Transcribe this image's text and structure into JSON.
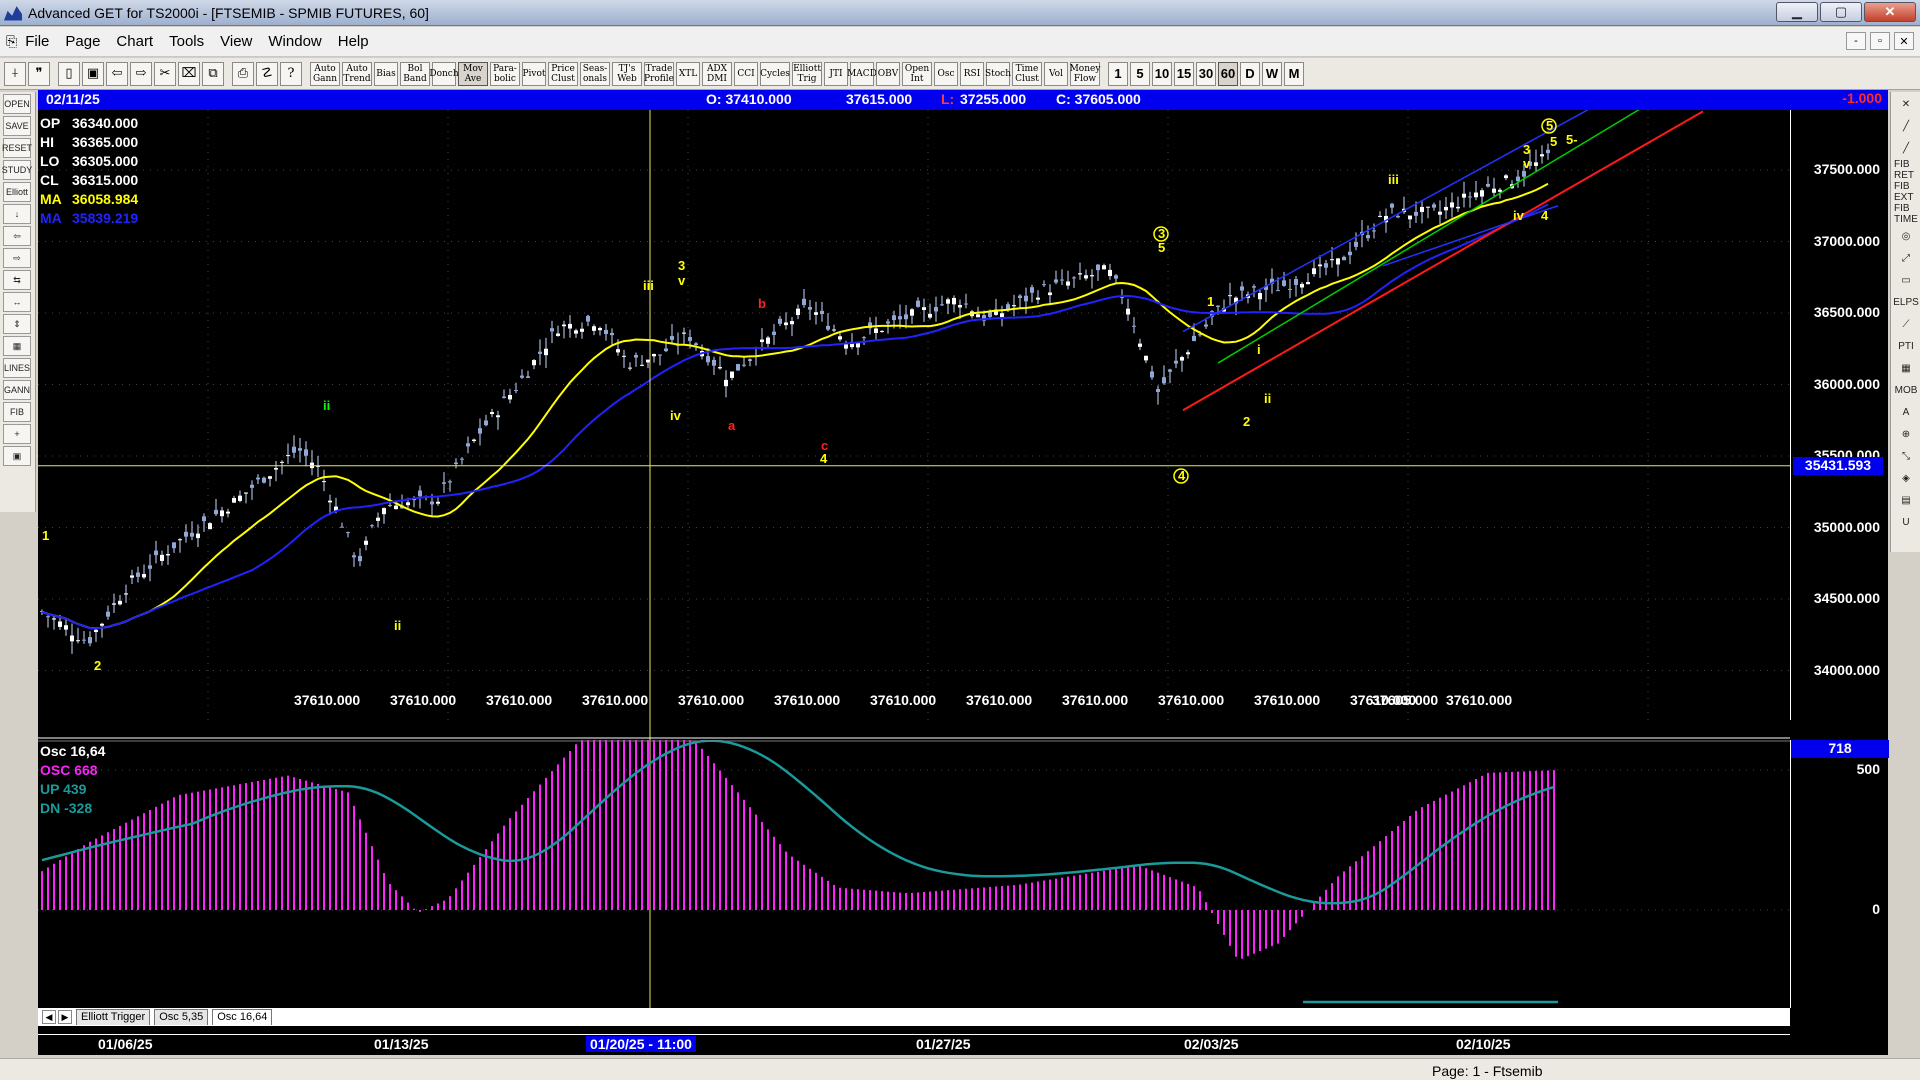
{
  "window": {
    "title": "Advanced GET for TS2000i - [FTSEMIB - SPMIB FUTURES, 60]"
  },
  "menu": [
    "File",
    "Page",
    "Chart",
    "Tools",
    "View",
    "Window",
    "Help"
  ],
  "toolbar_studies": [
    "Auto Gann",
    "Auto Trend",
    "Bias",
    "Bol Band",
    "Donch",
    "Mov Ave",
    "Para- bolic",
    "Pivot",
    "Price Clust",
    "Seas- onals",
    "TJ's Web",
    "Trade Profile",
    "XTL",
    "ADX DMI",
    "CCI",
    "Cycles",
    "Elliott Trig",
    "JTI",
    "MACD",
    "OBV",
    "Open Int",
    "Osc",
    "RSI",
    "Stoch",
    "Time Clust",
    "Vol",
    "Money Flow"
  ],
  "toolbar_periods": [
    "1",
    "5",
    "10",
    "15",
    "30",
    "60",
    "D",
    "W",
    "M"
  ],
  "left_tools": [
    "OPEN",
    "SAVE",
    "RESET",
    "STUDY",
    "Elliott",
    "↓",
    "⇦",
    "⇨",
    "⇆",
    "↔",
    "⇕",
    "▦",
    "LINES",
    "GANN",
    "FIB",
    "+",
    "▣"
  ],
  "right_tools": [
    "✕",
    "╱",
    "╱",
    "FIB RET",
    "FIB EXT",
    "FIB TIME",
    "◎",
    "⤢",
    "▭",
    "ELPS",
    "⟋",
    "PTI",
    "▦",
    "MOB",
    "A",
    "⊕",
    "⤡",
    "◈",
    "▤",
    "U"
  ],
  "infobar": {
    "date": "02/11/25",
    "open": "O: 37410.000",
    "high": "37615.000",
    "low_label": "L:",
    "low": "37255.000",
    "close": "C: 37605.000",
    "last": "-1.000"
  },
  "stats": [
    {
      "k": "OP",
      "v": "36340.000",
      "color": "#ffffff"
    },
    {
      "k": "HI",
      "v": "36365.000",
      "color": "#ffffff"
    },
    {
      "k": "LO",
      "v": "36305.000",
      "color": "#ffffff"
    },
    {
      "k": "CL",
      "v": "36315.000",
      "color": "#ffffff"
    },
    {
      "k": "MA",
      "v": "36058.984",
      "color": "#ffff00"
    },
    {
      "k": "MA",
      "v": "35839.219",
      "color": "#2222ff"
    }
  ],
  "price_axis": [
    "37500.000",
    "37000.000",
    "36500.000",
    "36000.000",
    "35500.000",
    "35000.000",
    "34500.000",
    "34000.000"
  ],
  "price_axis_values": [
    37500,
    37000,
    36500,
    36000,
    35500,
    35000,
    34500,
    34000
  ],
  "crosshair_price": "35431.593",
  "crosshair_value": 35431.593,
  "bottom_values": [
    "37610.000",
    "37610.000",
    "37610.000",
    "37610.000",
    "37610.000",
    "37610.000",
    "37610.000",
    "37610.000",
    "37610.000",
    "37610.000",
    "37610.000",
    "37610.000",
    "37610.000",
    "37605.000"
  ],
  "osc": {
    "title": "Osc 16,64",
    "osc": "OSC 668",
    "up": "UP  439",
    "dn": "DN  -328",
    "badge": "718",
    "axis": [
      "500",
      "0"
    ],
    "axis_values": [
      500,
      0
    ]
  },
  "tabs": [
    "Elliott Trigger",
    "Osc 5,35",
    "Osc 16,64"
  ],
  "dates": [
    {
      "label": "01/06/25",
      "hl": false
    },
    {
      "label": "01/13/25",
      "hl": false
    },
    {
      "label": "01/20/25 - 11:00",
      "hl": true
    },
    {
      "label": "01/27/25",
      "hl": false
    },
    {
      "label": "02/03/25",
      "hl": false
    },
    {
      "label": "02/10/25",
      "hl": false
    }
  ],
  "status": {
    "page": "Page: 1 - Ftsemib"
  },
  "elliott_labels": [
    {
      "t": "1",
      "c": "#ffff00"
    },
    {
      "t": "2",
      "c": "#ffff00"
    },
    {
      "t": "ii",
      "c": "#00ff00"
    },
    {
      "t": "ii",
      "c": "#ffff00"
    },
    {
      "t": "iii",
      "c": "#ffff00"
    },
    {
      "t": "3",
      "c": "#ffff00"
    },
    {
      "t": "v",
      "c": "#ffff00"
    },
    {
      "t": "iv",
      "c": "#ffff00"
    },
    {
      "t": "a",
      "c": "#ff2222"
    },
    {
      "t": "b",
      "c": "#ff2222"
    },
    {
      "t": "c",
      "c": "#ff2222"
    },
    {
      "t": "4",
      "c": "#ffff00"
    },
    {
      "t": "3",
      "c": "#ffff00"
    },
    {
      "t": "5",
      "c": "#ffff00"
    },
    {
      "t": "4",
      "c": "#ffff00"
    },
    {
      "t": "1",
      "c": "#ffff00"
    },
    {
      "t": "2",
      "c": "#ffff00"
    },
    {
      "t": "i",
      "c": "#ffff00"
    },
    {
      "t": "ii",
      "c": "#ffff00"
    },
    {
      "t": "iii",
      "c": "#ffff00"
    },
    {
      "t": "3",
      "c": "#ffff00"
    },
    {
      "t": "v",
      "c": "#ffff00"
    },
    {
      "t": "iv",
      "c": "#ffff00"
    },
    {
      "t": "4",
      "c": "#ffff00"
    },
    {
      "t": "5",
      "c": "#ffff00"
    },
    {
      "t": "5-",
      "c": "#ffff00"
    },
    {
      "t": "5",
      "c": "#ffff00"
    }
  ],
  "colors": {
    "ma_fast": "#ffff00",
    "ma_slow": "#2222ff",
    "osc": "#ff22ff",
    "osc_signal": "#1a9a9a",
    "channel_red": "#ff1a1a",
    "channel_green": "#00cc00",
    "channel_blue": "#2233ff",
    "crosshair": "#e8e860"
  }
}
